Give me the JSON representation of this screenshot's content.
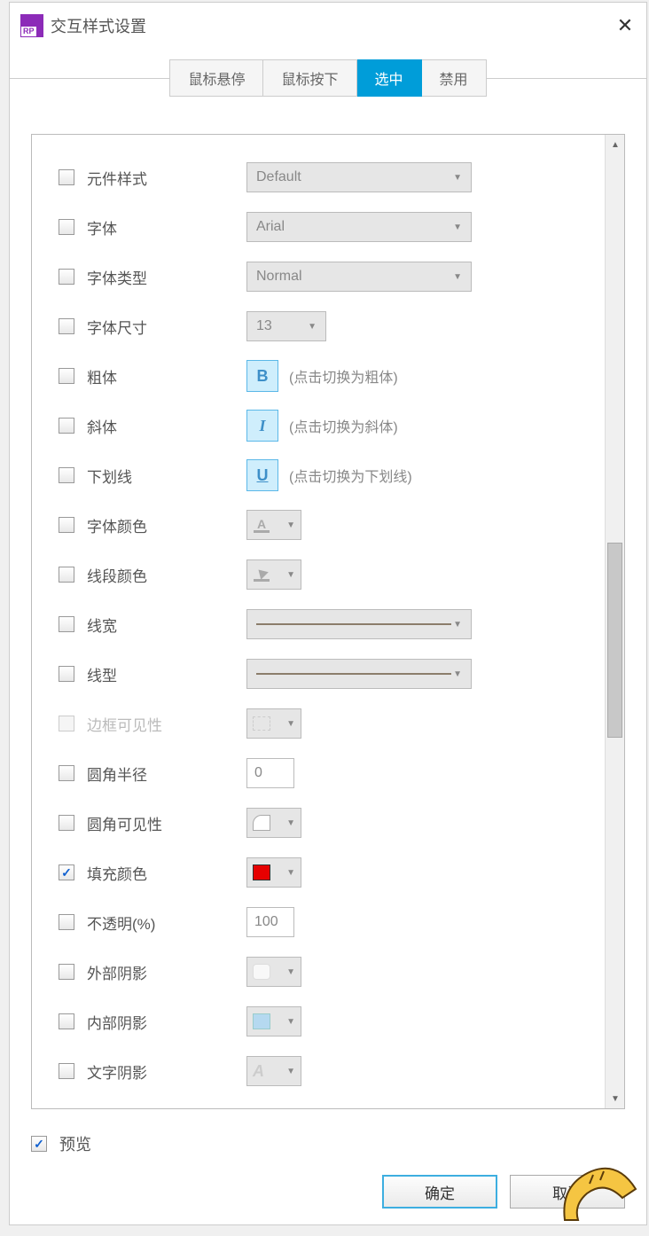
{
  "app_icon_label": "RP",
  "title": "交互样式设置",
  "tabs": [
    "鼠标悬停",
    "鼠标按下",
    "选中",
    "禁用"
  ],
  "active_tab_index": 2,
  "props": {
    "widget_style": {
      "label": "元件样式",
      "value": "Default"
    },
    "font": {
      "label": "字体",
      "value": "Arial"
    },
    "font_type": {
      "label": "字体类型",
      "value": "Normal"
    },
    "font_size": {
      "label": "字体尺寸",
      "value": "13"
    },
    "bold": {
      "label": "粗体",
      "glyph": "B",
      "hint": "(点击切换为粗体)"
    },
    "italic": {
      "label": "斜体",
      "glyph": "I",
      "hint": "(点击切换为斜体)"
    },
    "underline": {
      "label": "下划线",
      "glyph": "U",
      "hint": "(点击切换为下划线)"
    },
    "font_color": {
      "label": "字体颜色"
    },
    "line_color": {
      "label": "线段颜色"
    },
    "line_width": {
      "label": "线宽"
    },
    "line_style": {
      "label": "线型"
    },
    "border_vis": {
      "label": "边框可见性"
    },
    "corner_radius": {
      "label": "圆角半径",
      "value": "0"
    },
    "corner_vis": {
      "label": "圆角可见性"
    },
    "fill_color": {
      "label": "填充颜色",
      "value": "#e60000",
      "checked": true
    },
    "opacity": {
      "label": "不透明(%)",
      "value": "100"
    },
    "outer_shadow": {
      "label": "外部阴影"
    },
    "inner_shadow": {
      "label": "内部阴影"
    },
    "text_shadow": {
      "label": "文字阴影",
      "glyph": "A"
    }
  },
  "preview_label": "预览",
  "buttons": {
    "ok": "确定",
    "cancel": "取消"
  }
}
